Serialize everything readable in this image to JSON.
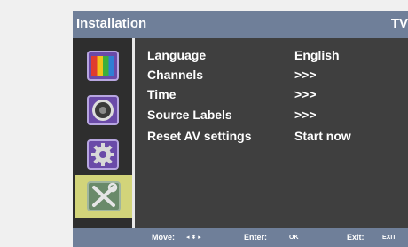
{
  "header": {
    "title": "Installation",
    "right_label": "TV"
  },
  "sidebar": {
    "items": [
      {
        "icon": "picture-icon",
        "selected": false
      },
      {
        "icon": "sound-icon",
        "selected": false
      },
      {
        "icon": "settings-icon",
        "selected": false
      },
      {
        "icon": "installation-tools-icon",
        "selected": true
      }
    ]
  },
  "menu": {
    "items": [
      {
        "label": "Language",
        "value": "English"
      },
      {
        "label": "Channels",
        "value": ">>>"
      },
      {
        "label": "Time",
        "value": ">>>"
      },
      {
        "label": "Source Labels",
        "value": ">>>"
      },
      {
        "label": "Reset AV settings",
        "value": "Start now"
      }
    ]
  },
  "footer": {
    "move_label": "Move:",
    "move_keys": "◂ ⬍ ▸",
    "enter_label": "Enter:",
    "enter_key": "OK",
    "exit_label": "Exit:",
    "exit_key": "EXIT"
  },
  "colors": {
    "bar": "#6f7f99",
    "panel": "#3f3f3f",
    "sidebar": "#2e2e2e",
    "highlight": "#d2d47a",
    "page_background": "#f0f0f0"
  }
}
